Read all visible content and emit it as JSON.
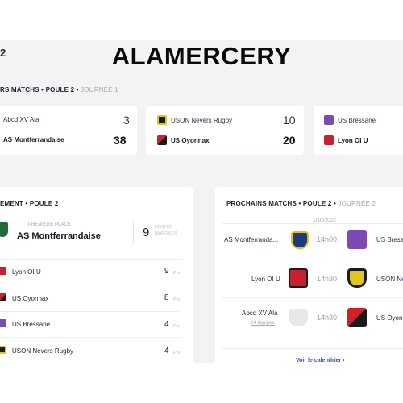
{
  "overlay": {
    "title": "ALAMERCERY"
  },
  "header": {
    "corner": "2"
  },
  "results": {
    "title": "RS MATCHS • POULE 2 •",
    "journee": "JOURNÉE 1",
    "matches": [
      {
        "home": "Abcd XV Ala",
        "home_score": "3",
        "away": "AS Montferrandaise",
        "away_score": "38"
      },
      {
        "home": "USON Nevers Rugby",
        "home_score": "10",
        "away": "US Oyonnax",
        "away_score": "20"
      },
      {
        "home": "US Bressane",
        "home_score": "",
        "away": "Lyon OI U",
        "away_score": ""
      }
    ]
  },
  "standings": {
    "title": "EMENT • POULE 2",
    "leader_label": "PREMIÈRE PLACE",
    "leader_name": "AS Montferrandaise",
    "leader_points": "9",
    "leader_points_label_1": "POINTS",
    "leader_points_label_2": "MARQUÉS",
    "pts_suffix": "Pts",
    "rows": [
      {
        "team": "Lyon OI U",
        "points": "9"
      },
      {
        "team": "US Oyonnax",
        "points": "8"
      },
      {
        "team": "US Bressane",
        "points": "4"
      },
      {
        "team": "USON Nevers Rugby",
        "points": "4"
      }
    ]
  },
  "upcoming": {
    "title": "PROCHAINS MATCHS • POULE 2 •",
    "journee": "JOURNÉE 2",
    "date": "1/10/2022",
    "matches": [
      {
        "home": "AS Montferranda...",
        "time": "14h00",
        "away": "US Bress",
        "sub": ""
      },
      {
        "home": "Lyon OI U",
        "time": "14h30",
        "away": "USON Ne",
        "sub": ""
      },
      {
        "home": "Abcd XV Ala",
        "time": "14h30",
        "away": "US Oyon",
        "sub": "24 équipes"
      }
    ],
    "calendar_link": "Voir le calendrier  ›"
  },
  "colors": {
    "background": "#f2f3f5",
    "card": "#ffffff",
    "link": "#2f55c4",
    "muted": "#a3a8b0"
  }
}
